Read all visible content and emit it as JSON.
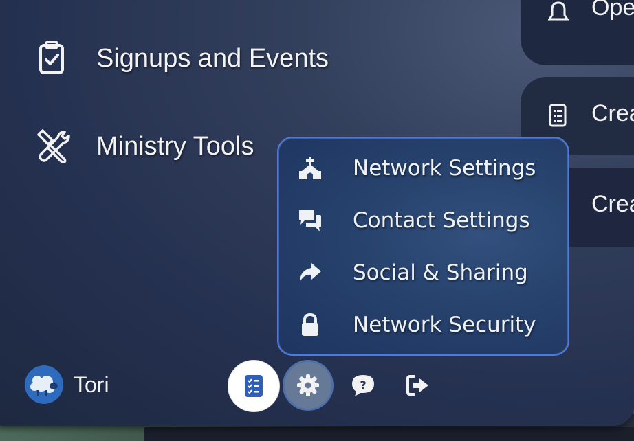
{
  "right_cards": [
    {
      "label": "Ope",
      "icon": "bell-icon"
    },
    {
      "label": "Crea",
      "icon": "checklist-icon"
    },
    {
      "label": "Crea",
      "icon": "people-icon"
    }
  ],
  "nav": {
    "items": [
      {
        "label": "Signups and Events",
        "icon": "clipboard-check-icon"
      },
      {
        "label": "Ministry Tools",
        "icon": "tools-icon"
      }
    ]
  },
  "settings_menu": {
    "items": [
      {
        "label": "Network Settings",
        "icon": "church-icon"
      },
      {
        "label": "Contact Settings",
        "icon": "chat-bubbles-icon"
      },
      {
        "label": "Social & Sharing",
        "icon": "share-arrow-icon"
      },
      {
        "label": "Network Security",
        "icon": "lock-icon"
      }
    ]
  },
  "user": {
    "name": "Tori",
    "avatar_icon": "sheep-avatar-icon"
  },
  "toolbar": {
    "buttons": [
      {
        "name": "checklist",
        "icon": "checklist-icon",
        "active": false
      },
      {
        "name": "settings",
        "icon": "gear-icon",
        "active": true
      },
      {
        "name": "help",
        "icon": "help-icon",
        "active": false
      },
      {
        "name": "logout",
        "icon": "logout-icon",
        "active": false
      }
    ]
  },
  "colors": {
    "accent": "#4c7ae0",
    "popup_bg": "#27436e",
    "panel_bg": "#253150",
    "checklist_icon": "#2f5fb8"
  }
}
